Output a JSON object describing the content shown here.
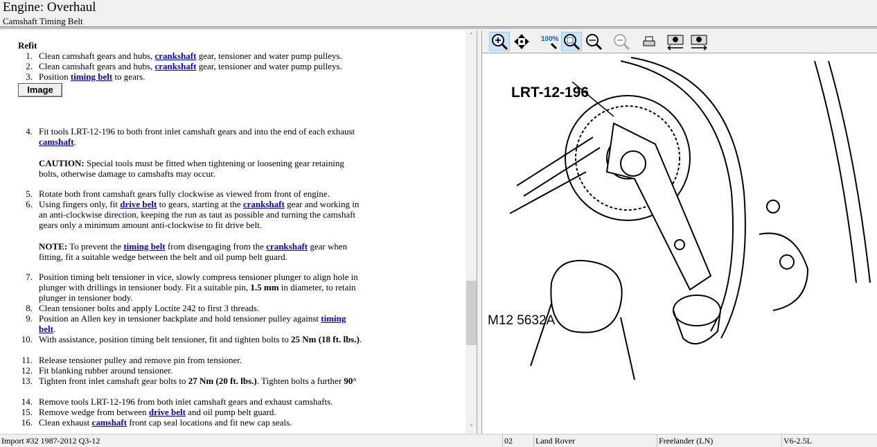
{
  "header": {
    "title": "Engine:  Overhaul",
    "subtitle": "Camshaft Timing Belt"
  },
  "content": {
    "section": "Refit",
    "image_button": "Image",
    "items": [
      {
        "n": "1.",
        "pre": "Clean camshaft gears and hubs, ",
        "link": "crankshaft",
        "post": " gear, tensioner and water pump pulleys."
      },
      {
        "n": "2.",
        "pre": "Clean camshaft gears and hubs, ",
        "link": "crankshaft",
        "post": " gear, tensioner and water pump pulleys."
      },
      {
        "n": "3.",
        "pre": "Position ",
        "link": "timing belt",
        "post": " to gears."
      },
      {
        "n": "4.",
        "pre": "Fit tools LRT-12-196 to both front inlet camshaft gears and into the end of each exhaust ",
        "link": "camshaft",
        "post": "."
      },
      {
        "n": "5.",
        "text": "Rotate both front camshaft gears fully clockwise as viewed from front of engine."
      },
      {
        "n": "6.",
        "pre": "Using fingers only, fit ",
        "link": "drive belt",
        "mid": " to gears, starting at the ",
        "link2": "crankshaft",
        "post": " gear and working in an anti-clockwise direction, keeping the run as taut as possible and turning the camshaft gears only a minimum amount anti-clockwise to fit drive belt."
      },
      {
        "n": "7.",
        "pre": "Position timing belt tensioner in vice, slowly compress tensioner plunger to align hole in plunger with drillings in tensioner body. Fit a suitable pin, ",
        "bold": "1.5 mm",
        "post": " in diameter, to retain plunger in tensioner body."
      },
      {
        "n": "8.",
        "text": "Clean tensioner bolts and apply Loctite 242 to first 3 threads."
      },
      {
        "n": "9.",
        "pre": "Position an Allen key in tensioner backplate and hold tensioner pulley against ",
        "link": "timing belt",
        "post": "."
      },
      {
        "n": "10.",
        "pre": "With assistance, position timing belt tensioner, fit and tighten bolts to ",
        "bold": "25 Nm (18 ft. lbs.)",
        "post": "."
      },
      {
        "n": "11.",
        "text": "Release tensioner pulley and remove pin from tensioner."
      },
      {
        "n": "12.",
        "text": "Fit blanking rubber around tensioner."
      },
      {
        "n": "13.",
        "pre": "Tighten front inlet camshaft gear bolts to ",
        "bold": "27 Nm (20 ft. lbs.)",
        "mid": ". Tighten bolts a further ",
        "bold2": "90°"
      },
      {
        "n": "14.",
        "text": "Remove tools LRT-12-196 from both inlet camshaft gears and exhaust camshafts."
      },
      {
        "n": "15.",
        "pre": "Remove wedge from between ",
        "link": "drive belt",
        "post": " and oil pump belt guard."
      },
      {
        "n": "16.",
        "pre": "Clean exhaust ",
        "link": "camshaft",
        "post": " front cap seal locations and fit new cap seals."
      }
    ],
    "caution": {
      "label": "CAUTION:",
      "text": "  Special tools must be fitted when tightening or loosening gear retaining bolts, otherwise damage to camshafts may occur."
    },
    "note": {
      "label": "NOTE:",
      "pre": "  To prevent the ",
      "link": "timing belt",
      "mid": " from disengaging from the ",
      "link2": "crankshaft",
      "post": " gear when fitting, fit a suitable wedge between the belt and oil pump belt guard."
    }
  },
  "toolbar": [
    "zoom-in",
    "pan",
    "zoom-100",
    "zoom-fit",
    "zoom-width",
    "zoom-out",
    "print",
    "previous-image",
    "next-image"
  ],
  "illustration": {
    "tool_label": "LRT-12-196",
    "ref": "M12 5632A"
  },
  "status": {
    "import": "Import #32 1987-2012 Q3-12",
    "code": "02",
    "make": "Land Rover",
    "model": "Freelander (LN)",
    "engine": "V6-2.5L"
  },
  "colors": {
    "link": "#0000ee",
    "toolbar_active": "#cce4f7"
  }
}
